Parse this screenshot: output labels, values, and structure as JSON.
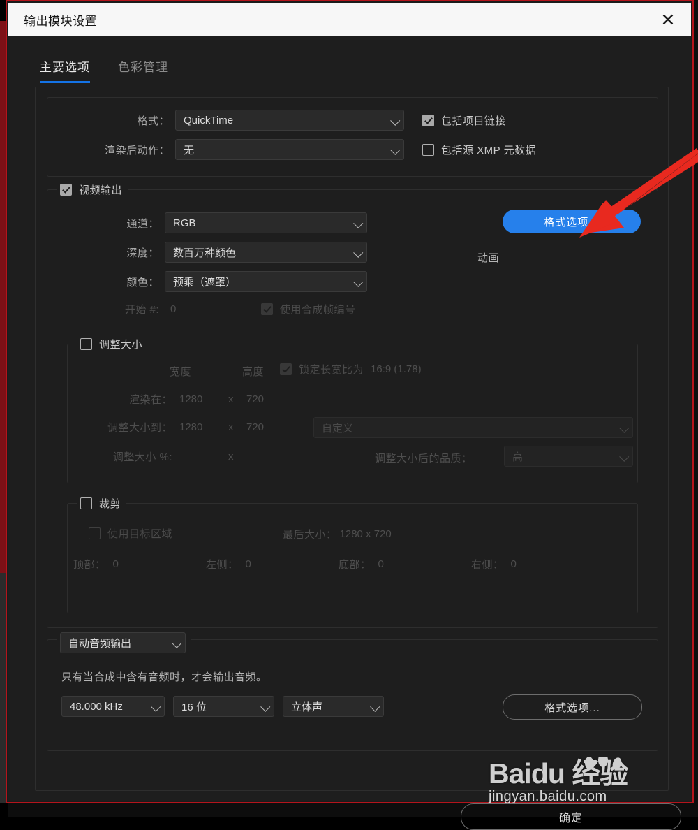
{
  "window": {
    "title": "输出模块设置",
    "close_icon": "close-icon"
  },
  "tabs": [
    {
      "label": "主要选项",
      "active": true
    },
    {
      "label": "色彩管理",
      "active": false
    }
  ],
  "format_section": {
    "format_label": "格式：",
    "format_value": "QuickTime",
    "post_render_label": "渲染后动作：",
    "post_render_value": "无",
    "include_project_link": {
      "label": "包括项目链接",
      "checked": true
    },
    "include_xmp": {
      "label": "包括源 XMP 元数据",
      "checked": false
    }
  },
  "video_section": {
    "legend": {
      "label": "视频输出",
      "checked": true
    },
    "channel_label": "通道：",
    "channel_value": "RGB",
    "depth_label": "深度：",
    "depth_value": "数百万种颜色",
    "color_label": "颜色：",
    "color_value": "预乘（遮罩）",
    "start_label": "开始 #:",
    "start_value": "0",
    "use_comp_frame_number": {
      "label": "使用合成帧编号",
      "checked": true
    },
    "format_options_button": "格式选项...",
    "format_options_value": "动画"
  },
  "resize_section": {
    "legend": {
      "label": "调整大小",
      "checked": false
    },
    "col_width": "宽度",
    "col_height": "高度",
    "lock_aspect": {
      "label": "锁定长宽比为",
      "value": "16:9 (1.78)",
      "checked": true
    },
    "render_at_label": "渲染在：",
    "render_at_width": "1280",
    "render_at_sep": "x",
    "render_at_height": "720",
    "resize_to_label": "调整大小到：",
    "resize_to_width": "1280",
    "resize_to_sep": "x",
    "resize_to_height": "720",
    "preset_value": "自定义",
    "resize_pct_label": "调整大小 %:",
    "resize_pct_sep": "x",
    "quality_label": "调整大小后的品质：",
    "quality_value": "高"
  },
  "crop_section": {
    "legend": {
      "label": "裁剪",
      "checked": false
    },
    "use_region_of_interest": {
      "label": "使用目标区域",
      "checked": false
    },
    "final_size_label": "最后大小：",
    "final_size_value": "1280 x 720",
    "top_label": "顶部：",
    "top_value": "0",
    "left_label": "左侧：",
    "left_value": "0",
    "bottom_label": "底部：",
    "bottom_value": "0",
    "right_label": "右侧：",
    "right_value": "0"
  },
  "audio_section": {
    "mode_value": "自动音频输出",
    "note": "只有当合成中含有音频时，才会输出音频。",
    "sample_rate": "48.000 kHz",
    "bit_depth": "16 位",
    "channels": "立体声",
    "format_options_button": "格式选项..."
  },
  "footer": {
    "confirm_label": "确定"
  },
  "watermark": {
    "brand": "Bai",
    "brand2": "du",
    "brand_cn": "经验",
    "url": "jingyan.baidu.com"
  },
  "colors": {
    "accent_blue": "#2680eb",
    "tab_underline": "#1473e6",
    "arrow_red": "#e8291f",
    "frame_red": "#b4141c",
    "dialog_bg": "#1e1e1e",
    "titlebar_bg": "#f7f7f7"
  }
}
